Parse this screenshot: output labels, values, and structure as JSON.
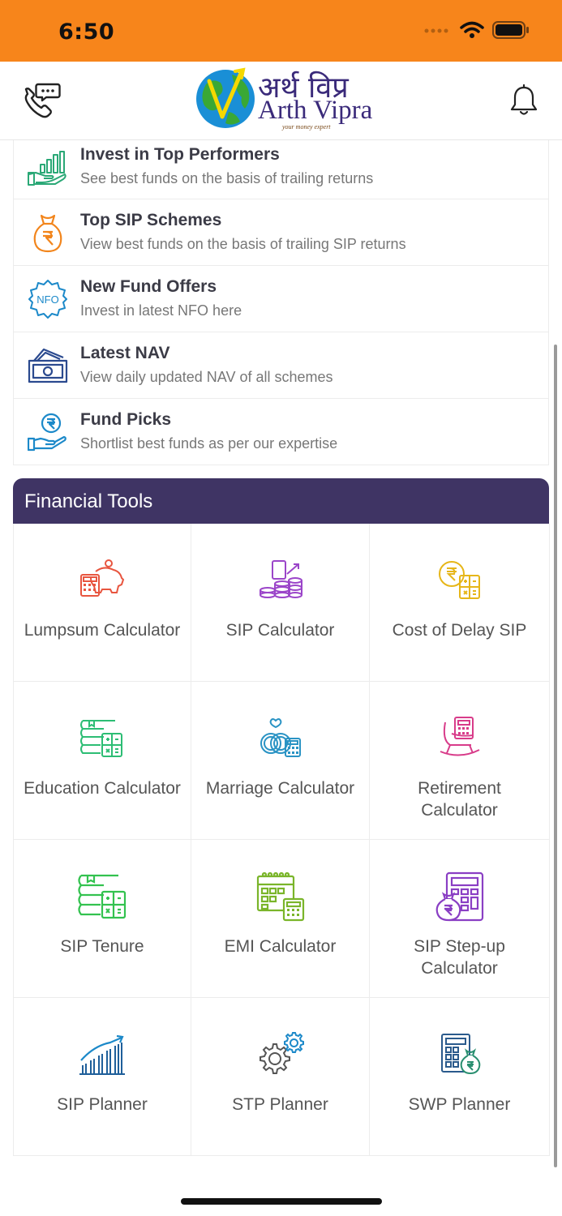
{
  "status_bar": {
    "time": "6:50"
  },
  "brand": {
    "name_hindi": "अर्थ विप्र",
    "name_english": "Arth Vipra",
    "tagline": "your money expert"
  },
  "colors": {
    "status_bar": "#f7851b",
    "tools_header": "#3f3464"
  },
  "explore_items": [
    {
      "title": "Invest in Top Performers",
      "subtitle": "See best funds on the basis of trailing returns",
      "icon": "growth-chart-hand-icon"
    },
    {
      "title": "Top SIP Schemes",
      "subtitle": "View best funds on the basis of trailing SIP returns",
      "icon": "rupee-money-bag-icon"
    },
    {
      "title": "New Fund Offers",
      "subtitle": "Invest in latest NFO here",
      "icon": "nfo-badge-icon",
      "icon_text": "NFO"
    },
    {
      "title": "Latest NAV",
      "subtitle": "View daily updated NAV of all schemes",
      "icon": "cash-stack-icon"
    },
    {
      "title": "Fund Picks",
      "subtitle": "Shortlist best funds as per our expertise",
      "icon": "rupee-hand-icon"
    }
  ],
  "financial_tools": {
    "title": "Financial Tools",
    "tools": [
      {
        "label": "Lumpsum Calculator",
        "icon": "piggy-bank-calculator-icon"
      },
      {
        "label": "SIP Calculator",
        "icon": "coins-calculator-icon"
      },
      {
        "label": "Cost of Delay SIP",
        "icon": "rupee-coin-calculator-icon"
      },
      {
        "label": "Education Calculator",
        "icon": "books-calculator-icon"
      },
      {
        "label": "Marriage Calculator",
        "icon": "rings-calculator-icon"
      },
      {
        "label": "Retirement Calculator",
        "icon": "rocking-chair-icon"
      },
      {
        "label": "SIP Tenure",
        "icon": "books-calculator-icon"
      },
      {
        "label": "EMI Calculator",
        "icon": "calendar-calculator-icon"
      },
      {
        "label": "SIP Step-up Calculator",
        "icon": "money-bag-calculator-icon"
      },
      {
        "label": "SIP Planner",
        "icon": "growth-bars-icon"
      },
      {
        "label": "STP Planner",
        "icon": "gears-icon"
      },
      {
        "label": "SWP Planner",
        "icon": "calculator-money-bag-icon"
      }
    ]
  }
}
